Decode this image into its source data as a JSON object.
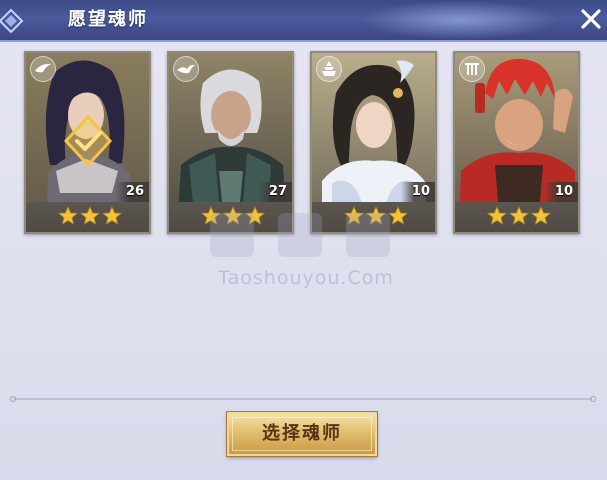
{
  "header": {
    "title": "愿望魂师",
    "close_icon": "close-icon"
  },
  "cards": [
    {
      "level": "26",
      "stars": 3,
      "selected": true,
      "class_icon": "wing-icon"
    },
    {
      "level": "27",
      "stars": 3,
      "selected": false,
      "class_icon": "bird-icon"
    },
    {
      "level": "10",
      "stars": 3,
      "selected": false,
      "class_icon": "tower-icon"
    },
    {
      "level": "10",
      "stars": 3,
      "selected": false,
      "class_icon": "gate-icon"
    }
  ],
  "watermark": "Taoshouyou.Com",
  "select_button": {
    "label": "选择魂师"
  },
  "colors": {
    "header": "#3c4a86",
    "star": "#f2c33a",
    "button_gold": "#dfbb6a",
    "button_text": "#5a3316"
  }
}
